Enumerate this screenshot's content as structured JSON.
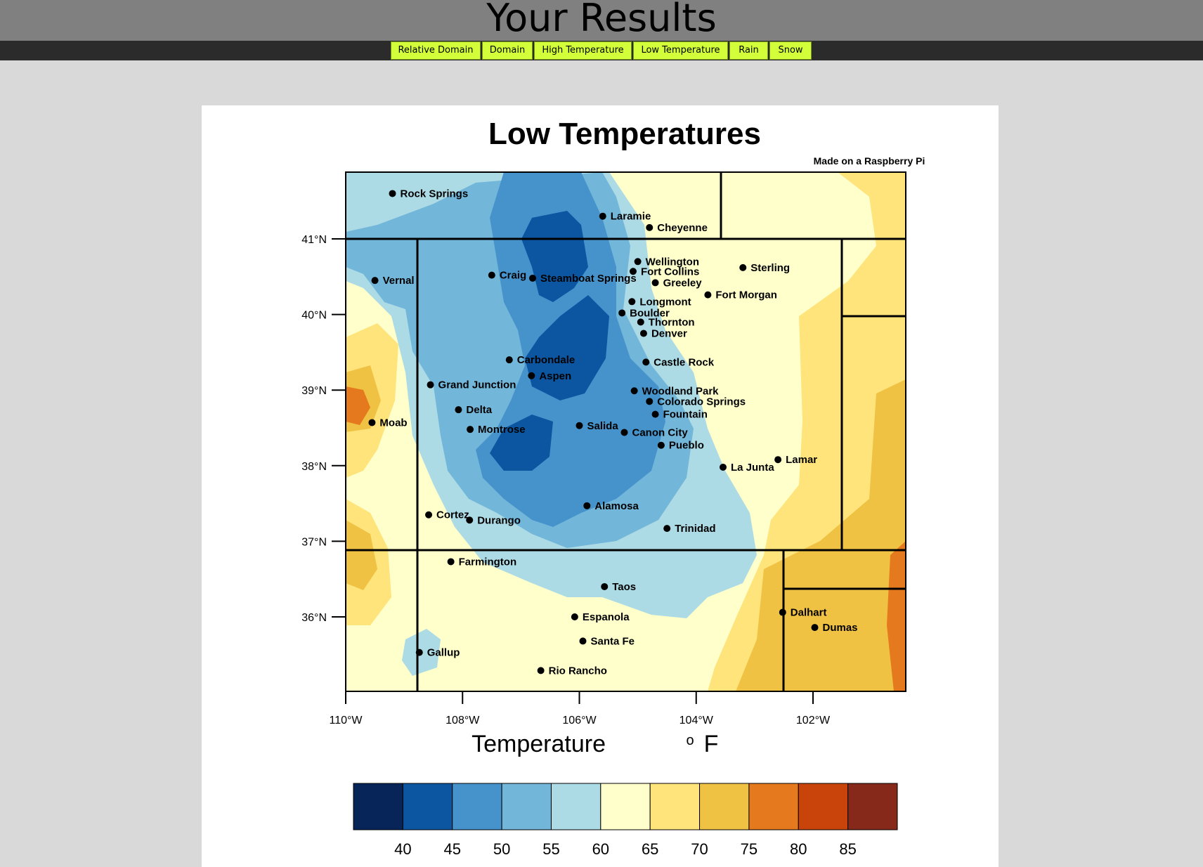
{
  "page": {
    "title": "Your Results"
  },
  "nav": {
    "buttons": [
      "Relative Domain",
      "Domain",
      "High Temperature",
      "Low Temperature",
      "Rain",
      "Snow"
    ]
  },
  "map": {
    "title": "Low Temperatures",
    "credit": "Made on a Raspberry Pi",
    "xlabel": "Temperature",
    "xlabel_unit_sup": "o",
    "xlabel_unit": "F",
    "lat_labels": [
      "41°N",
      "40°N",
      "39°N",
      "38°N",
      "37°N",
      "36°N"
    ],
    "lon_labels": [
      "110°W",
      "108°W",
      "106°W",
      "104°W",
      "102°W"
    ],
    "colorbar": {
      "colors": [
        "#08255a",
        "#0b55a1",
        "#4693cc",
        "#72b6da",
        "#acdbe6",
        "#ffffcc",
        "#fee47a",
        "#f0c244",
        "#e5791d",
        "#c9440b",
        "#86281a"
      ],
      "labels": [
        "40",
        "45",
        "50",
        "55",
        "60",
        "65",
        "70",
        "75",
        "80",
        "85"
      ]
    },
    "cities": [
      {
        "name": "Rock Springs",
        "lon": -109.2,
        "lat": 41.6
      },
      {
        "name": "Laramie",
        "lon": -105.6,
        "lat": 41.3
      },
      {
        "name": "Cheyenne",
        "lon": -104.8,
        "lat": 41.15
      },
      {
        "name": "Vernal",
        "lon": -109.5,
        "lat": 40.45
      },
      {
        "name": "Craig",
        "lon": -107.5,
        "lat": 40.52
      },
      {
        "name": "Steamboat Springs",
        "lon": -106.8,
        "lat": 40.48
      },
      {
        "name": "Wellington",
        "lon": -105.0,
        "lat": 40.7
      },
      {
        "name": "Fort Collins",
        "lon": -105.08,
        "lat": 40.57
      },
      {
        "name": "Greeley",
        "lon": -104.7,
        "lat": 40.42
      },
      {
        "name": "Sterling",
        "lon": -103.2,
        "lat": 40.62
      },
      {
        "name": "Fort Morgan",
        "lon": -103.8,
        "lat": 40.26
      },
      {
        "name": "Longmont",
        "lon": -105.1,
        "lat": 40.17
      },
      {
        "name": "Boulder",
        "lon": -105.27,
        "lat": 40.02
      },
      {
        "name": "Thornton",
        "lon": -104.95,
        "lat": 39.9
      },
      {
        "name": "Denver",
        "lon": -104.9,
        "lat": 39.75
      },
      {
        "name": "Castle Rock",
        "lon": -104.86,
        "lat": 39.37
      },
      {
        "name": "Carbondale",
        "lon": -107.2,
        "lat": 39.4
      },
      {
        "name": "Aspen",
        "lon": -106.82,
        "lat": 39.19
      },
      {
        "name": "Grand Junction",
        "lon": -108.55,
        "lat": 39.07
      },
      {
        "name": "Woodland Park",
        "lon": -105.06,
        "lat": 38.99
      },
      {
        "name": "Colorado Springs",
        "lon": -104.8,
        "lat": 38.85
      },
      {
        "name": "Fountain",
        "lon": -104.7,
        "lat": 38.68
      },
      {
        "name": "Delta",
        "lon": -108.07,
        "lat": 38.74
      },
      {
        "name": "Moab",
        "lon": -109.55,
        "lat": 38.57
      },
      {
        "name": "Salida",
        "lon": -106.0,
        "lat": 38.53
      },
      {
        "name": "Canon City",
        "lon": -105.23,
        "lat": 38.44
      },
      {
        "name": "Montrose",
        "lon": -107.87,
        "lat": 38.48
      },
      {
        "name": "Pueblo",
        "lon": -104.6,
        "lat": 38.27
      },
      {
        "name": "Lamar",
        "lon": -102.6,
        "lat": 38.08
      },
      {
        "name": "La Junta",
        "lon": -103.54,
        "lat": 37.98
      },
      {
        "name": "Alamosa",
        "lon": -105.87,
        "lat": 37.47
      },
      {
        "name": "Trinidad",
        "lon": -104.5,
        "lat": 37.17
      },
      {
        "name": "Cortez",
        "lon": -108.58,
        "lat": 37.35
      },
      {
        "name": "Durango",
        "lon": -107.88,
        "lat": 37.28
      },
      {
        "name": "Farmington",
        "lon": -108.2,
        "lat": 36.73
      },
      {
        "name": "Taos",
        "lon": -105.57,
        "lat": 36.4
      },
      {
        "name": "Dalhart",
        "lon": -102.52,
        "lat": 36.06
      },
      {
        "name": "Dumas",
        "lon": -101.97,
        "lat": 35.86
      },
      {
        "name": "Espanola",
        "lon": -106.08,
        "lat": 36.0
      },
      {
        "name": "Santa Fe",
        "lon": -105.94,
        "lat": 35.68
      },
      {
        "name": "Gallup",
        "lon": -108.74,
        "lat": 35.53
      },
      {
        "name": "Rio Rancho",
        "lon": -106.66,
        "lat": 35.29
      }
    ]
  }
}
